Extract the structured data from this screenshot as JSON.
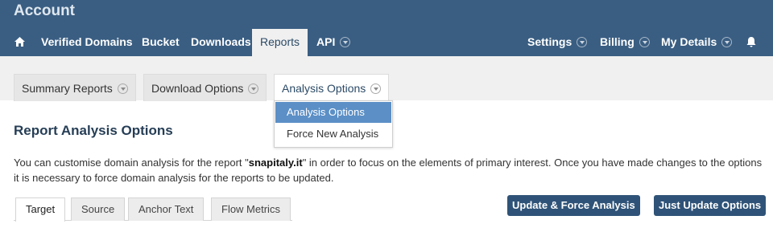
{
  "app": {
    "title": "Account"
  },
  "nav": {
    "left": [
      {
        "label": "Verified Domains"
      },
      {
        "label": "Bucket"
      },
      {
        "label": "Downloads"
      },
      {
        "label": "Reports"
      },
      {
        "label": "API"
      }
    ],
    "right": [
      {
        "label": "Settings"
      },
      {
        "label": "Billing"
      },
      {
        "label": "My Details"
      }
    ],
    "home_icon": "home-icon",
    "notifications_icon": "bell-icon"
  },
  "subnav": {
    "tabs": [
      {
        "label": "Summary Reports"
      },
      {
        "label": "Download Options"
      },
      {
        "label": "Analysis Options"
      }
    ]
  },
  "dropdown": {
    "items": [
      {
        "label": "Analysis Options"
      },
      {
        "label": "Force New Analysis"
      }
    ]
  },
  "main": {
    "title": "Report Analysis Options",
    "description_before": "You can customise domain analysis for the report \"",
    "description_domain": "snapitaly.it",
    "description_after": "\" in order to focus on the elements of primary interest. Once you have made changes to the options it is necessary to force domain analysis for the reports to be updated.",
    "tabs": [
      {
        "label": "Target"
      },
      {
        "label": "Source"
      },
      {
        "label": "Anchor Text"
      },
      {
        "label": "Flow Metrics"
      }
    ],
    "buttons": {
      "force": "Update & Force Analysis",
      "update": "Just Update Options"
    }
  },
  "colors": {
    "header": "#3a5e82",
    "button": "#2f5378",
    "dropdown_selected": "#5b8fc6",
    "title": "#263e56"
  }
}
